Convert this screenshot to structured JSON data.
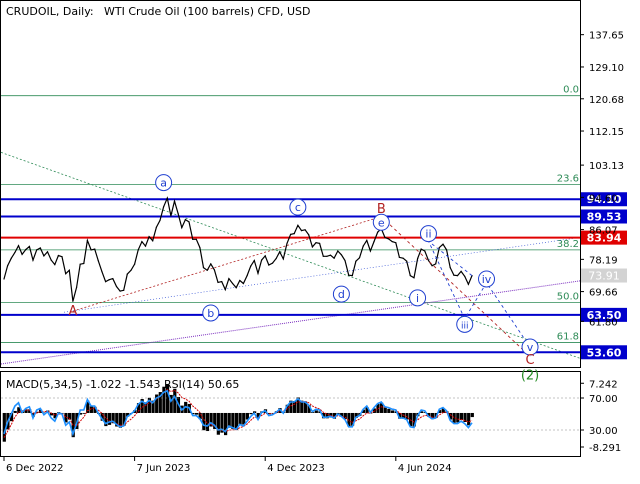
{
  "header": {
    "symbol": "CRUDOIL, Daily:",
    "description": "WTI Crude Oil (100 barrels) CFD, USD"
  },
  "colors": {
    "price": "#000000",
    "fib": "#2e8b57",
    "level_blue": "#0000cc",
    "level_red": "#e00000",
    "wave_blue": "#1f3fd0",
    "wave_red": "#b22222",
    "wave_green": "#228b22",
    "trend_purple": "#7b2fbf",
    "macd_signal": "#d40000",
    "rsi": "#1e90ff",
    "current_label_bg": "#d3d3d3"
  },
  "chart_data": [
    {
      "type": "line",
      "title": "CRUDOIL, Daily:",
      "subtitle": "WTI Crude Oil (100 barrels) CFD, USD",
      "xlabel": "",
      "ylabel": "",
      "ylim": [
        50.5,
        141.0
      ],
      "grid": false,
      "x_ticks": [
        "6 Dec 2022",
        "7 Jun 2023",
        "4 Dec 2023",
        "4 Jun 2024"
      ],
      "y_ticks": [
        61.8,
        69.66,
        78.19,
        86.07,
        94.6,
        103.13,
        112.15,
        120.68,
        129.1,
        137.65
      ],
      "series": [
        {
          "values": [
            73.0,
            76.5,
            78.5,
            80.0,
            81.8,
            79.5,
            80.8,
            81.6,
            78.0,
            80.7,
            81.2,
            79.1,
            80.2,
            78.0,
            76.8,
            79.2,
            78.9,
            74.4,
            75.3,
            67.1,
            70.8,
            76.9,
            77.1,
            83.2,
            80.7,
            80.9,
            77.8,
            74.9,
            72.3,
            72.8,
            73.1,
            71.0,
            69.8,
            70.0,
            74.3,
            75.3,
            76.9,
            80.7,
            82.9,
            81.7,
            84.2,
            83.1,
            86.7,
            88.5,
            92.1,
            94.4,
            89.7,
            93.6,
            90.3,
            86.6,
            88.7,
            88.1,
            83.5,
            83.5,
            81.3,
            76.0,
            75.3,
            77.0,
            75.4,
            72.1,
            72.3,
            70.2,
            73.1,
            71.8,
            70.7,
            72.6,
            71.8,
            73.9,
            76.4,
            77.9,
            74.5,
            78.0,
            79.1,
            76.7,
            77.2,
            78.4,
            80.2,
            78.3,
            82.4,
            84.8,
            85.0,
            87.2,
            85.8,
            86.0,
            84.7,
            81.5,
            82.6,
            82.4,
            79.0,
            79.0,
            79.3,
            78.5,
            80.4,
            79.4,
            77.9,
            74.0,
            73.9,
            77.7,
            78.6,
            81.7,
            83.2,
            80.4,
            82.9,
            85.4,
            86.3,
            84.0,
            83.6,
            82.9,
            82.6,
            78.7,
            78.5,
            77.7,
            73.9,
            73.3,
            78.4,
            80.9,
            80.4,
            77.9,
            76.5,
            77.0,
            81.3,
            82.2,
            80.7,
            76.0,
            74.0,
            73.9,
            75.0,
            73.7,
            71.6,
            73.9
          ],
          "high": 95.2,
          "low": 64.2
        }
      ],
      "current_price": "73.91",
      "price_levels": [
        {
          "label": "94.10",
          "value": 94.1,
          "color": "blue"
        },
        {
          "label": "89.53",
          "value": 89.53,
          "color": "blue"
        },
        {
          "label": "83.94",
          "value": 83.94,
          "color": "red"
        },
        {
          "label": "63.50",
          "value": 63.5,
          "color": "blue"
        },
        {
          "label": "53.60",
          "value": 53.6,
          "color": "blue"
        }
      ],
      "fib_levels": [
        {
          "label": "0.0",
          "value": 121.5
        },
        {
          "label": "23.6",
          "value": 98.0
        },
        {
          "label": "38.2",
          "value": 80.7
        },
        {
          "label": "50.0",
          "value": 66.8
        },
        {
          "label": "61.8",
          "value": 56.2
        }
      ],
      "wave_labels": [
        {
          "text": "A",
          "x": 19,
          "y": 64.5,
          "style": "red-plain"
        },
        {
          "text": "a",
          "x": 44,
          "y": 98.5,
          "style": "blue-circle"
        },
        {
          "text": "b",
          "x": 57,
          "y": 64.0,
          "style": "blue-circle"
        },
        {
          "text": "c",
          "x": 81,
          "y": 92.0,
          "style": "blue-circle"
        },
        {
          "text": "d",
          "x": 93,
          "y": 69.0,
          "style": "blue-circle"
        },
        {
          "text": "B",
          "x": 104,
          "y": 91.5,
          "style": "red-plain"
        },
        {
          "text": "e",
          "x": 104,
          "y": 88.0,
          "style": "blue-circle"
        },
        {
          "text": "i",
          "x": 114,
          "y": 68.0,
          "style": "blue-circle"
        },
        {
          "text": "ii",
          "x": 117,
          "y": 85.0,
          "style": "blue-circle"
        },
        {
          "text": "iii",
          "x": 127,
          "y": 61.0,
          "style": "blue-circle"
        },
        {
          "text": "iv",
          "x": 133,
          "y": 73.0,
          "style": "blue-circle"
        },
        {
          "text": "v",
          "x": 145,
          "y": 55.0,
          "style": "blue-circle"
        },
        {
          "text": "C",
          "x": 145,
          "y": 51.5,
          "style": "red-plain"
        },
        {
          "text": "(2)",
          "x": 145,
          "y": 47.5,
          "style": "green-plain"
        }
      ]
    },
    {
      "type": "line",
      "title": "MACD(5,34,5) -1.022 -1.543 RSI(14) 50.65",
      "xlabel": "",
      "ylabel": "",
      "ylim": [
        -10.0,
        9.5
      ],
      "y_ticks": [
        7.242,
        70.0,
        30.0,
        -8.291
      ],
      "series": [
        {
          "name": "MACD(5,34,5)",
          "last_value": -1.022,
          "type": "histogram",
          "values": [
            -7.0,
            -4.0,
            -2.0,
            0.5,
            1.4,
            0.6,
            0.9,
            0.9,
            -0.9,
            0.3,
            0.8,
            0.1,
            0.6,
            -0.6,
            -1.3,
            0.2,
            0.0,
            -2.3,
            -1.6,
            -5.9,
            -3.9,
            -0.4,
            -0.2,
            3.0,
            1.6,
            1.5,
            -0.2,
            -1.9,
            -3.2,
            -2.9,
            -2.5,
            -3.3,
            -3.6,
            -3.1,
            -0.9,
            -0.1,
            0.7,
            2.4,
            3.4,
            2.6,
            3.7,
            3.0,
            4.5,
            5.1,
            6.4,
            7.0,
            4.4,
            5.9,
            3.9,
            1.8,
            2.7,
            2.2,
            -0.3,
            -0.4,
            -1.5,
            -4.2,
            -4.4,
            -3.3,
            -3.9,
            -5.3,
            -4.8,
            -5.4,
            -3.6,
            -3.9,
            -4.1,
            -2.8,
            -2.8,
            -1.6,
            -0.3,
            0.4,
            -1.3,
            0.4,
            0.9,
            -0.3,
            -0.1,
            0.4,
            1.2,
            0.2,
            2.0,
            3.0,
            2.9,
            3.8,
            3.0,
            2.8,
            1.9,
            0.2,
            0.6,
            0.4,
            -1.3,
            -1.3,
            -1.1,
            -1.4,
            -0.4,
            -0.8,
            -1.5,
            -3.3,
            -3.1,
            -1.2,
            -0.7,
            0.8,
            1.4,
            0.0,
            1.1,
            2.2,
            2.5,
            1.3,
            1.0,
            0.6,
            0.4,
            -1.4,
            -1.4,
            -1.6,
            -3.2,
            -3.3,
            -0.8,
            0.4,
            0.2,
            -0.9,
            -1.5,
            -1.2,
            0.7,
            1.1,
            0.4,
            -1.6,
            -2.4,
            -2.3,
            -1.7,
            -2.2,
            -3.0,
            -1.0
          ]
        },
        {
          "name": "signal",
          "values": [
            -6.0,
            -4.5,
            -2.8,
            -1.0,
            0.2,
            0.5,
            0.7,
            0.7,
            0.0,
            0.0,
            0.3,
            0.3,
            0.4,
            0.0,
            -0.5,
            -0.3,
            -0.2,
            -1.0,
            -1.3,
            -2.9,
            -3.2,
            -2.0,
            -1.0,
            0.5,
            1.0,
            1.2,
            0.7,
            -0.1,
            -1.2,
            -1.9,
            -2.2,
            -2.6,
            -3.0,
            -3.0,
            -2.2,
            -1.5,
            -0.7,
            0.4,
            1.4,
            1.8,
            2.5,
            2.7,
            3.4,
            4.0,
            4.9,
            5.7,
            5.2,
            5.5,
            4.9,
            3.8,
            3.4,
            2.9,
            1.7,
            1.0,
            0.1,
            -1.5,
            -2.5,
            -2.8,
            -3.2,
            -3.9,
            -4.2,
            -4.6,
            -4.2,
            -4.1,
            -4.1,
            -3.6,
            -3.3,
            -2.7,
            -1.8,
            -1.0,
            -1.1,
            -0.6,
            -0.1,
            -0.2,
            -0.2,
            0.0,
            0.5,
            0.4,
            1.0,
            1.7,
            2.1,
            2.7,
            2.8,
            2.8,
            2.5,
            1.7,
            1.3,
            1.0,
            0.2,
            -0.3,
            -0.6,
            -0.9,
            -0.7,
            -0.8,
            -1.0,
            -1.8,
            -2.3,
            -1.9,
            -1.5,
            -0.7,
            0.0,
            0.0,
            0.4,
            1.0,
            1.5,
            1.4,
            1.3,
            1.0,
            0.8,
            0.0,
            -0.5,
            -0.9,
            -1.7,
            -2.2,
            -1.7,
            -1.0,
            -0.6,
            -0.7,
            -1.0,
            -1.1,
            -0.5,
            0.1,
            0.2,
            -0.4,
            -1.1,
            -1.5,
            -1.6,
            -1.8,
            -2.2,
            -1.8
          ]
        },
        {
          "name": "RSI(14)",
          "last_value": 50.65,
          "values": [
            25.0,
            40.0,
            50.0,
            60.0,
            64.0,
            52.0,
            57.0,
            59.0,
            45.0,
            55.0,
            57.0,
            49.0,
            53.0,
            45.0,
            41.0,
            51.0,
            50.0,
            36.0,
            40.0,
            25.0,
            38.0,
            55.0,
            55.0,
            68.0,
            60.0,
            60.0,
            51.0,
            44.0,
            38.0,
            40.0,
            41.0,
            37.0,
            34.0,
            35.0,
            47.0,
            50.0,
            54.0,
            62.0,
            66.0,
            63.0,
            67.0,
            64.0,
            70.0,
            72.0,
            77.0,
            79.0,
            66.0,
            72.0,
            63.0,
            55.0,
            59.0,
            58.0,
            48.0,
            48.0,
            44.0,
            36.0,
            35.0,
            39.0,
            36.0,
            30.0,
            31.0,
            28.0,
            35.0,
            33.0,
            31.0,
            37.0,
            35.0,
            41.0,
            47.0,
            51.0,
            43.0,
            52.0,
            54.0,
            48.0,
            49.0,
            52.0,
            56.0,
            51.0,
            60.0,
            65.0,
            65.0,
            69.0,
            65.0,
            65.0,
            61.0,
            53.0,
            56.0,
            55.0,
            46.0,
            46.0,
            47.0,
            45.0,
            50.0,
            47.0,
            43.0,
            34.0,
            34.0,
            46.0,
            48.0,
            56.0,
            60.0,
            52.0,
            58.0,
            63.0,
            65.0,
            59.0,
            58.0,
            56.0,
            55.0,
            45.0,
            45.0,
            43.0,
            34.0,
            33.0,
            48.0,
            55.0,
            54.0,
            47.0,
            44.0,
            45.0,
            56.0,
            58.0,
            54.0,
            42.0,
            38.0,
            38.0,
            41.0,
            38.0,
            33.0,
            39.0
          ]
        }
      ],
      "rsi_levels": [
        70,
        30
      ]
    }
  ]
}
